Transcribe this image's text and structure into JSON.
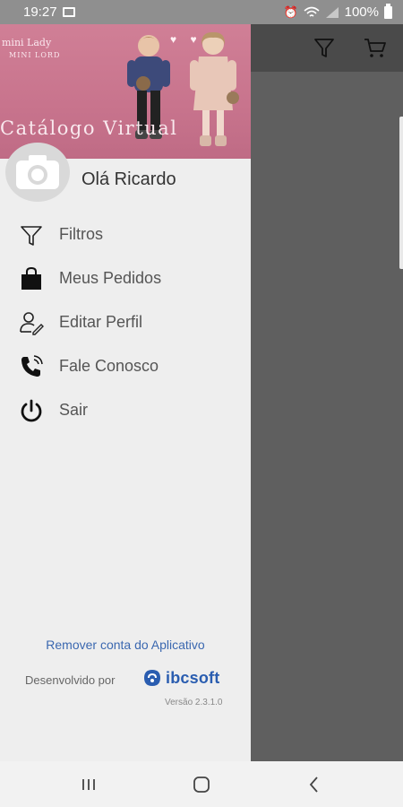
{
  "status_bar": {
    "time": "19:27",
    "battery": "100%"
  },
  "banner": {
    "brand_line1": "mini Lady",
    "brand_line2": "MINI LORD",
    "title": "Catálogo Virtual"
  },
  "drawer": {
    "greeting": "Olá Ricardo",
    "menu": [
      {
        "label": "Filtros",
        "icon": "filter-icon"
      },
      {
        "label": "Meus Pedidos",
        "icon": "shopping-bag-icon"
      },
      {
        "label": "Editar Perfil",
        "icon": "edit-profile-icon"
      },
      {
        "label": "Fale Conosco",
        "icon": "phone-icon"
      },
      {
        "label": "Sair",
        "icon": "power-icon"
      }
    ],
    "remove_account": "Remover conta do Aplicativo",
    "developed_by": "Desenvolvido por",
    "developer_logo": "ibcsoft",
    "version": "Versão 2.3.1.0"
  },
  "toolbar": {
    "icons": [
      "filter-icon",
      "cart-icon"
    ]
  },
  "colors": {
    "banner": "#c8748d",
    "drawer_bg": "#eeeeee",
    "scrim": "#5f5f5f",
    "link": "#3b68b0",
    "brand_blue": "#2a5db0"
  }
}
